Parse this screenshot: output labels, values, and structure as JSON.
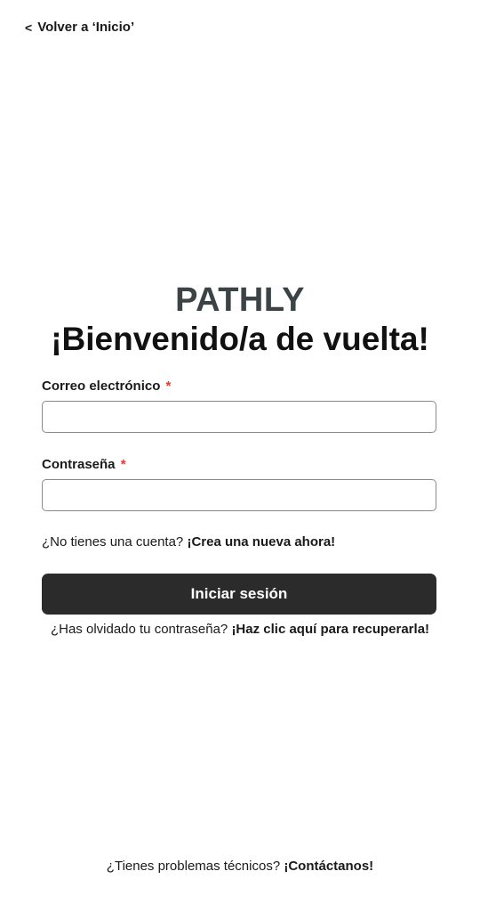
{
  "nav": {
    "back_chevron": "<",
    "back_label": "Volver a ‘Inicio’"
  },
  "brand": {
    "logo_text": "PATHLY"
  },
  "heading": {
    "title": "¡Bienvenido/a de vuelta!"
  },
  "form": {
    "email_label": "Correo electrónico",
    "password_label": "Contraseña",
    "required_marker": "*",
    "email_value": "",
    "password_value": "",
    "submit_label": "Iniciar sesión"
  },
  "signup": {
    "prompt": "¿No tienes una cuenta?",
    "cta": "¡Crea una nueva ahora!"
  },
  "forgot": {
    "prompt": "¿Has olvidado tu contraseña?",
    "cta": "¡Haz clic aquí para recuperarla!"
  },
  "footer": {
    "prompt": "¿Tienes problemas técnicos?",
    "cta": "¡Contáctanos!"
  },
  "colors": {
    "logo": "#3b4347",
    "button_bg": "#2b2b2b",
    "required": "#e53935"
  },
  "icons": {
    "back": "chevron-left-icon"
  }
}
